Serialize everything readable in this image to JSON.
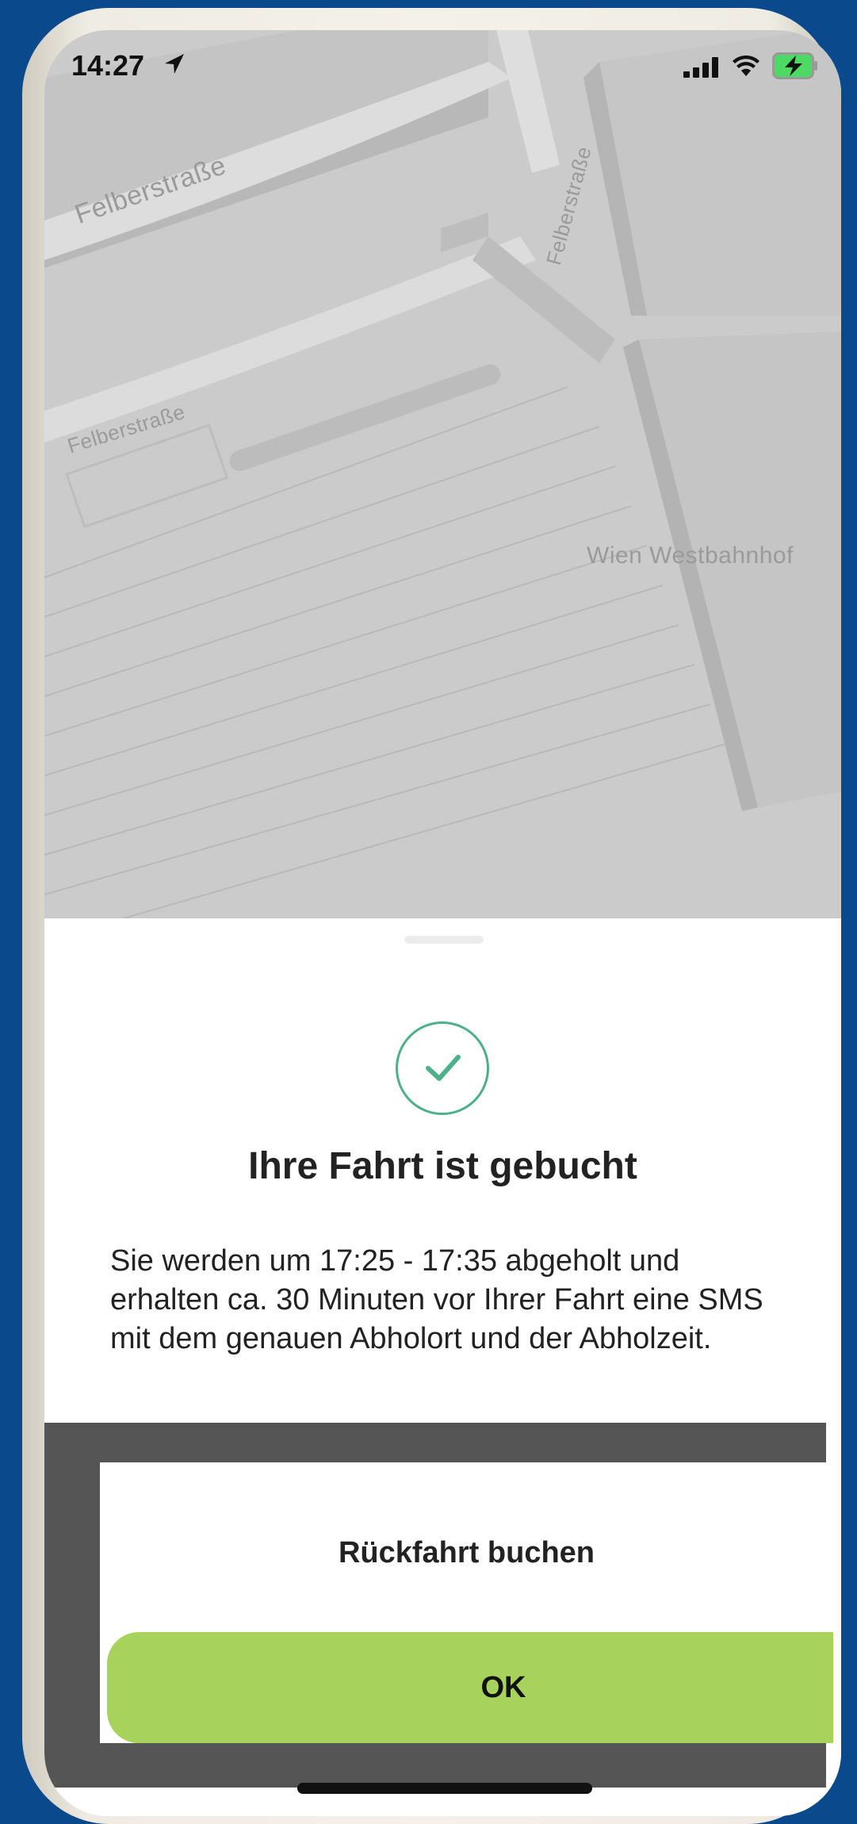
{
  "status_bar": {
    "time": "14:27",
    "icons": [
      "location-arrow-icon",
      "cellular-signal-icon",
      "wifi-icon",
      "battery-charging-icon"
    ]
  },
  "map": {
    "labels": {
      "street_1": "Felberstraße",
      "street_2": "Felberstraße",
      "street_3": "Felberstraße",
      "station": "Wien Westbahnhof"
    }
  },
  "sheet": {
    "icon": "check-circle-icon",
    "title": "Ihre Fahrt ist gebucht",
    "description": "Sie werden um 17:25 - 17:35 abgeholt und erhalten ca. 30 Minuten vor Ihrer Fahrt eine SMS mit dem genauen Abholort und der Abholzeit.",
    "return_button_label": "Rückfahrt buchen",
    "ok_button_label": "OK"
  },
  "colors": {
    "background": "#0a4a8c",
    "accent_green": "#a7d35c",
    "check_green": "#4cb08a",
    "map_gray": "#cbcbcb",
    "overlay": "#555555"
  }
}
